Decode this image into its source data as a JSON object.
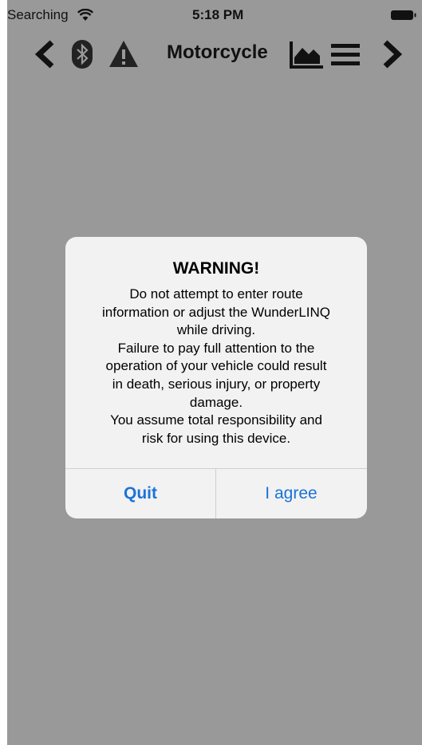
{
  "status_bar": {
    "carrier": "Searching",
    "time": "5:18 PM"
  },
  "nav_bar": {
    "title": "Motorcycle",
    "icons": [
      "chevron-left-icon",
      "bluetooth-icon",
      "warning-icon",
      "chart-icon",
      "menu-icon",
      "chevron-right-icon"
    ]
  },
  "alert": {
    "title": "WARNING!",
    "message_lines": [
      "Do not attempt to enter route",
      "information or adjust the WunderLINQ",
      "while driving.",
      "Failure to pay full attention to the",
      "operation of your vehicle could result",
      "in death, serious injury, or property",
      "damage.",
      "You assume total responsibility and",
      "risk for using this device."
    ],
    "buttons": {
      "quit": "Quit",
      "agree": "I agree"
    },
    "button_color": "#1a73d9"
  },
  "colors": {
    "dimmed_background": "#999999",
    "alert_background": "#f2f2f2"
  }
}
